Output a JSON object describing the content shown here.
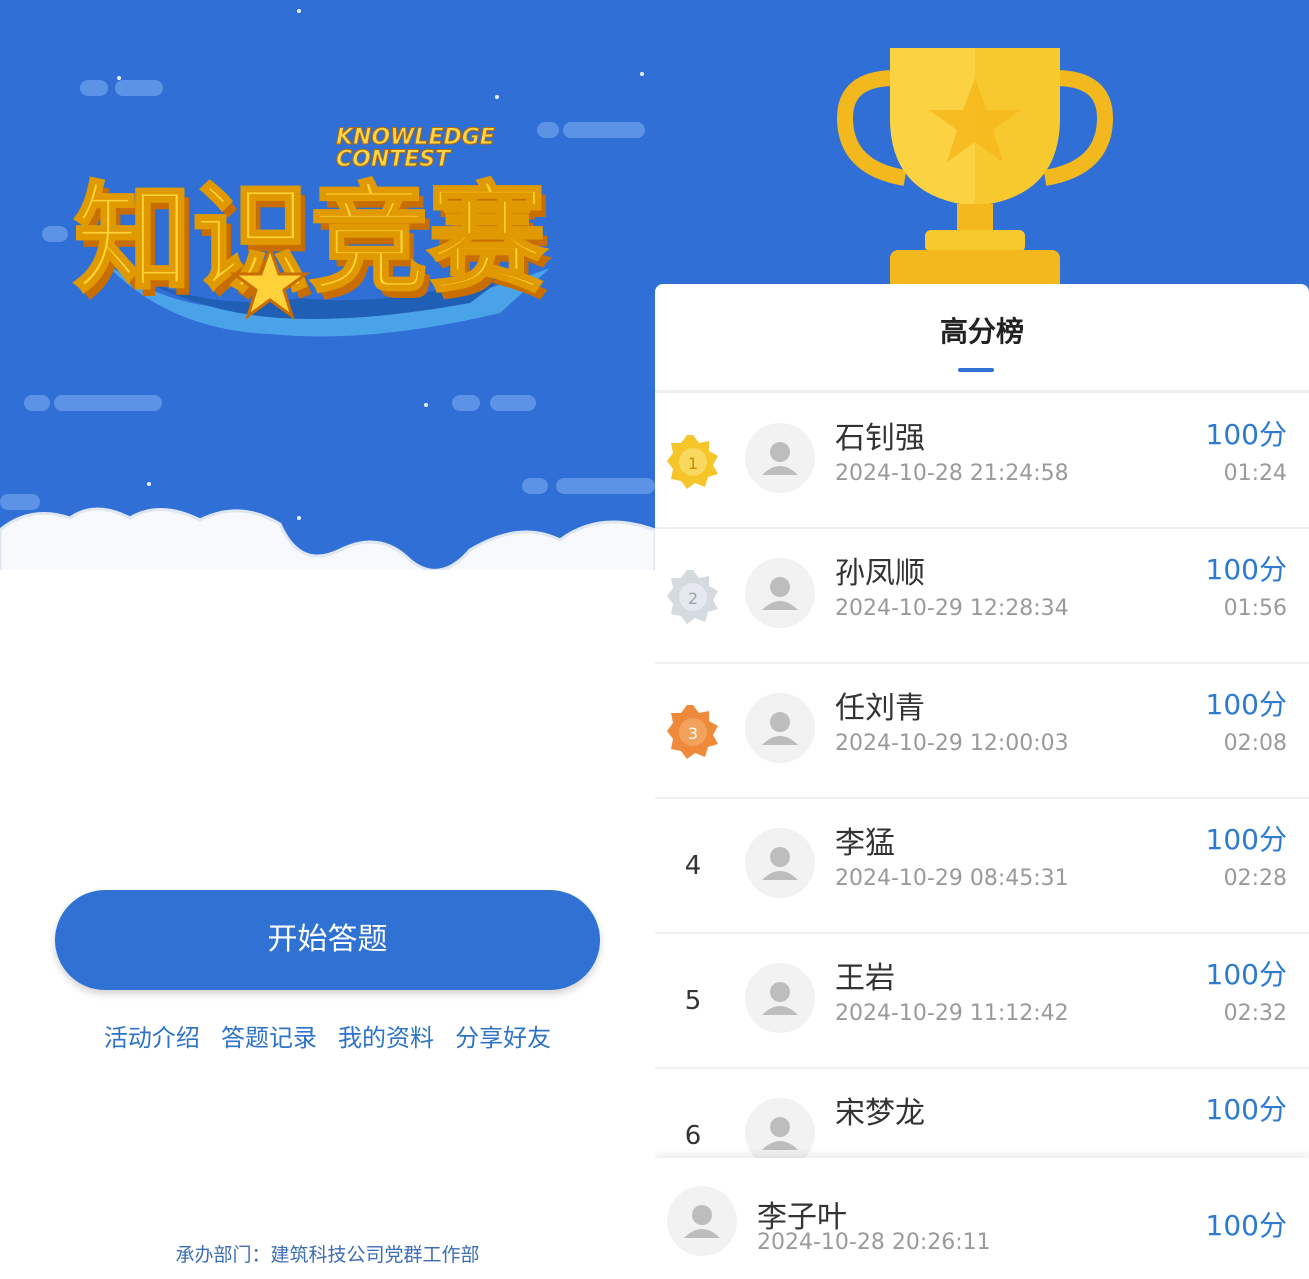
{
  "left": {
    "logo": {
      "en": "KNOWLEDGE CONTEST",
      "cn": "知识竞赛"
    },
    "start_button": "开始答题",
    "links": [
      "活动介绍",
      "答题记录",
      "我的资料",
      "分享好友"
    ],
    "footer": "承办部门：建筑科技公司党群工作部"
  },
  "leaderboard": {
    "title": "高分榜",
    "rows": [
      {
        "rank": "1",
        "name": "石钊强",
        "date": "2024-10-28 21:24:58",
        "score": "100分",
        "time": "01:24"
      },
      {
        "rank": "2",
        "name": "孙凤顺",
        "date": "2024-10-29 12:28:34",
        "score": "100分",
        "time": "01:56"
      },
      {
        "rank": "3",
        "name": "任刘青",
        "date": "2024-10-29 12:00:03",
        "score": "100分",
        "time": "02:08"
      },
      {
        "rank": "4",
        "name": "李猛",
        "date": "2024-10-29 08:45:31",
        "score": "100分",
        "time": "02:28"
      },
      {
        "rank": "5",
        "name": "王岩",
        "date": "2024-10-29 11:12:42",
        "score": "100分",
        "time": "02:32"
      },
      {
        "rank": "6",
        "name": "宋梦龙",
        "date": "",
        "score": "100分",
        "time": ""
      }
    ],
    "me": {
      "name": "李子叶",
      "date": "2024-10-28 20:26:11",
      "score": "100分"
    }
  },
  "colors": {
    "sky": "#2f6fd6",
    "button": "#2f72d4",
    "link": "#2d73c8",
    "gold": "#f5c52a",
    "silver": "#c9cfd6",
    "bronze": "#ef8a3a"
  }
}
